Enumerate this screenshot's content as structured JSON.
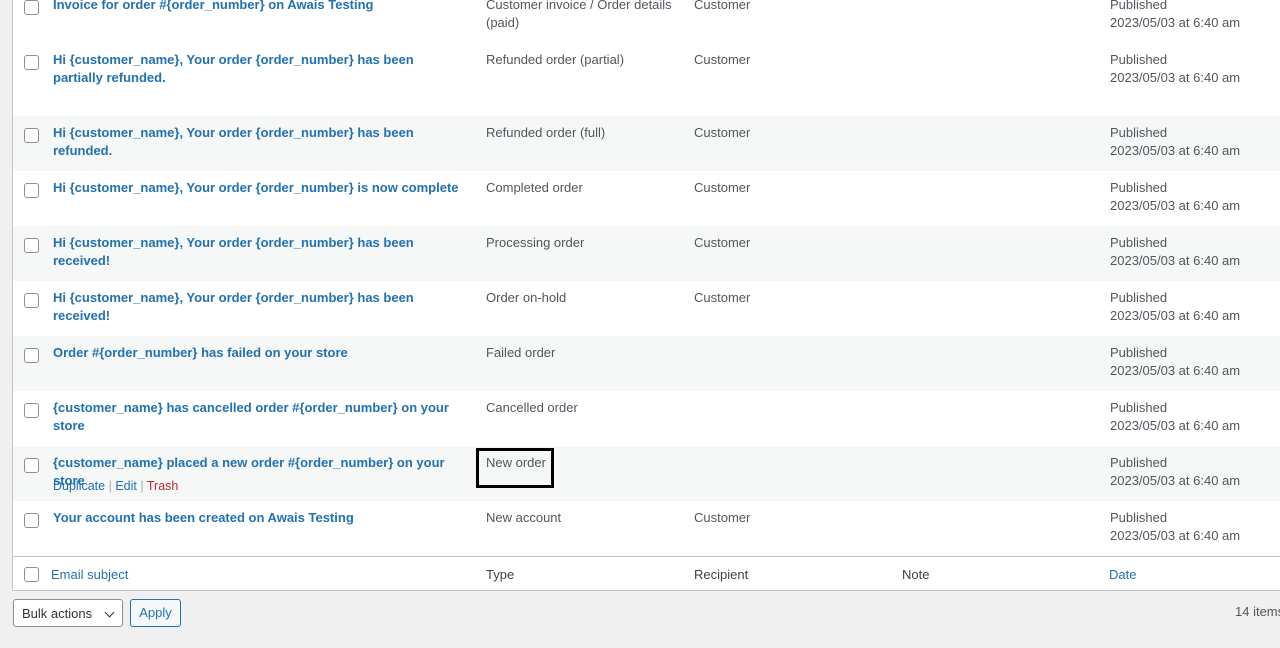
{
  "rows": [
    {
      "subject": "Invoice for order #{order_number} on Awais Testing",
      "type": "Customer invoice / Order details (paid)",
      "recipient": "Customer",
      "status": "Published",
      "date": "2023/05/03 at 6:40 am"
    },
    {
      "subject": "Hi {customer_name}, Your order {order_number} has been partially refunded.",
      "type": "Refunded order (partial)",
      "recipient": "Customer",
      "status": "Published",
      "date": "2023/05/03 at 6:40 am"
    },
    {
      "subject": "Hi {customer_name}, Your order {order_number} has been refunded.",
      "type": "Refunded order (full)",
      "recipient": "Customer",
      "status": "Published",
      "date": "2023/05/03 at 6:40 am"
    },
    {
      "subject": "Hi {customer_name}, Your order {order_number} is now complete",
      "type": "Completed order",
      "recipient": "Customer",
      "status": "Published",
      "date": "2023/05/03 at 6:40 am"
    },
    {
      "subject": "Hi {customer_name}, Your order {order_number} has been received!",
      "type": "Processing order",
      "recipient": "Customer",
      "status": "Published",
      "date": "2023/05/03 at 6:40 am"
    },
    {
      "subject": "Hi {customer_name}, Your order {order_number} has been received!",
      "type": "Order on-hold",
      "recipient": "Customer",
      "status": "Published",
      "date": "2023/05/03 at 6:40 am"
    },
    {
      "subject": "Order #{order_number} has failed on your store",
      "type": "Failed order",
      "recipient": "",
      "status": "Published",
      "date": "2023/05/03 at 6:40 am"
    },
    {
      "subject": "{customer_name} has cancelled order #{order_number} on your store",
      "type": "Cancelled order",
      "recipient": "",
      "status": "Published",
      "date": "2023/05/03 at 6:40 am"
    },
    {
      "subject": "{customer_name} placed a new order #{order_number} on your store",
      "type": "New order",
      "recipient": "",
      "status": "Published",
      "date": "2023/05/03 at 6:40 am"
    },
    {
      "subject": "Your account has been created on Awais Testing",
      "type": "New account",
      "recipient": "Customer",
      "status": "Published",
      "date": "2023/05/03 at 6:40 am"
    }
  ],
  "row_actions": {
    "duplicate": "Duplicate",
    "edit": "Edit",
    "trash": "Trash",
    "separator": "|"
  },
  "footer": {
    "email_subject": "Email subject",
    "type": "Type",
    "recipient": "Recipient",
    "note": "Note",
    "date": "Date"
  },
  "bulk_actions": {
    "selected": "Bulk actions",
    "apply": "Apply"
  },
  "item_count": "14 items",
  "colors": {
    "link": "#2271b1",
    "trash": "#b32d2e",
    "alt_row": "#f6f7f7",
    "background": "#f0f0f1"
  }
}
